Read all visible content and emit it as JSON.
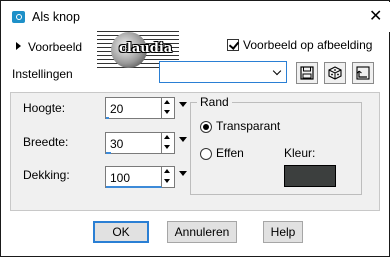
{
  "window": {
    "title": "Als knop",
    "close_glyph": "✕"
  },
  "preview": {
    "toggle_label": "Voorbeeld",
    "checkbox_label": "Voorbeeld op afbeelding",
    "checkbox_checked": true,
    "watermark_text": "claudia"
  },
  "settings": {
    "label": "Instellingen",
    "preset_value": "",
    "tools": [
      "save-preset-icon",
      "reset-dice-icon",
      "manage-presets-icon"
    ]
  },
  "fields": {
    "height": {
      "label": "Hoogte:",
      "value": "20"
    },
    "width": {
      "label": "Breedte:",
      "value": "30"
    },
    "opacity": {
      "label": "Dekking:",
      "value": "100"
    }
  },
  "border_group": {
    "title": "Rand",
    "transparent_label": "Transparant",
    "solid_label": "Effen",
    "selected": "Transparant",
    "color_label": "Kleur:",
    "color": "#3c3f3e"
  },
  "buttons": {
    "ok": "OK",
    "cancel": "Annuleren",
    "help": "Help"
  }
}
